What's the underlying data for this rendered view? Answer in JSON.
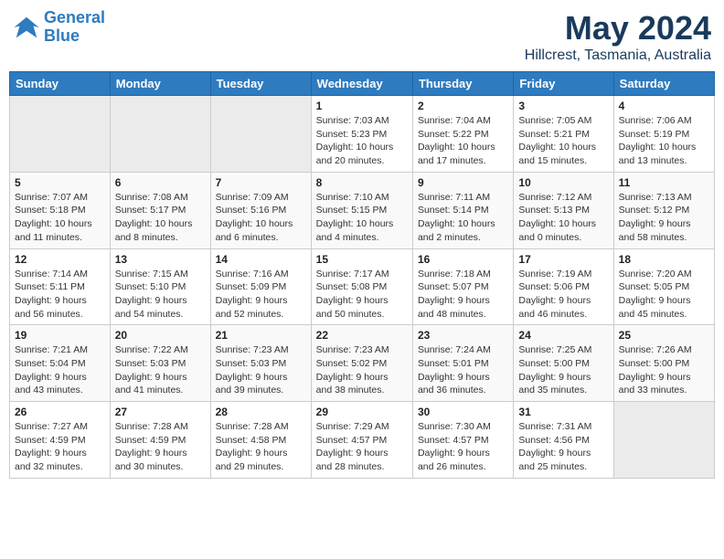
{
  "logo": {
    "line1": "General",
    "line2": "Blue"
  },
  "title": "May 2024",
  "subtitle": "Hillcrest, Tasmania, Australia",
  "weekdays": [
    "Sunday",
    "Monday",
    "Tuesday",
    "Wednesday",
    "Thursday",
    "Friday",
    "Saturday"
  ],
  "weeks": [
    {
      "days": [
        {
          "num": "",
          "info": "",
          "empty": true
        },
        {
          "num": "",
          "info": "",
          "empty": true
        },
        {
          "num": "",
          "info": "",
          "empty": true
        },
        {
          "num": "1",
          "info": "Sunrise: 7:03 AM\nSunset: 5:23 PM\nDaylight: 10 hours\nand 20 minutes."
        },
        {
          "num": "2",
          "info": "Sunrise: 7:04 AM\nSunset: 5:22 PM\nDaylight: 10 hours\nand 17 minutes."
        },
        {
          "num": "3",
          "info": "Sunrise: 7:05 AM\nSunset: 5:21 PM\nDaylight: 10 hours\nand 15 minutes."
        },
        {
          "num": "4",
          "info": "Sunrise: 7:06 AM\nSunset: 5:19 PM\nDaylight: 10 hours\nand 13 minutes."
        }
      ]
    },
    {
      "days": [
        {
          "num": "5",
          "info": "Sunrise: 7:07 AM\nSunset: 5:18 PM\nDaylight: 10 hours\nand 11 minutes."
        },
        {
          "num": "6",
          "info": "Sunrise: 7:08 AM\nSunset: 5:17 PM\nDaylight: 10 hours\nand 8 minutes."
        },
        {
          "num": "7",
          "info": "Sunrise: 7:09 AM\nSunset: 5:16 PM\nDaylight: 10 hours\nand 6 minutes."
        },
        {
          "num": "8",
          "info": "Sunrise: 7:10 AM\nSunset: 5:15 PM\nDaylight: 10 hours\nand 4 minutes."
        },
        {
          "num": "9",
          "info": "Sunrise: 7:11 AM\nSunset: 5:14 PM\nDaylight: 10 hours\nand 2 minutes."
        },
        {
          "num": "10",
          "info": "Sunrise: 7:12 AM\nSunset: 5:13 PM\nDaylight: 10 hours\nand 0 minutes."
        },
        {
          "num": "11",
          "info": "Sunrise: 7:13 AM\nSunset: 5:12 PM\nDaylight: 9 hours\nand 58 minutes."
        }
      ]
    },
    {
      "days": [
        {
          "num": "12",
          "info": "Sunrise: 7:14 AM\nSunset: 5:11 PM\nDaylight: 9 hours\nand 56 minutes."
        },
        {
          "num": "13",
          "info": "Sunrise: 7:15 AM\nSunset: 5:10 PM\nDaylight: 9 hours\nand 54 minutes."
        },
        {
          "num": "14",
          "info": "Sunrise: 7:16 AM\nSunset: 5:09 PM\nDaylight: 9 hours\nand 52 minutes."
        },
        {
          "num": "15",
          "info": "Sunrise: 7:17 AM\nSunset: 5:08 PM\nDaylight: 9 hours\nand 50 minutes."
        },
        {
          "num": "16",
          "info": "Sunrise: 7:18 AM\nSunset: 5:07 PM\nDaylight: 9 hours\nand 48 minutes."
        },
        {
          "num": "17",
          "info": "Sunrise: 7:19 AM\nSunset: 5:06 PM\nDaylight: 9 hours\nand 46 minutes."
        },
        {
          "num": "18",
          "info": "Sunrise: 7:20 AM\nSunset: 5:05 PM\nDaylight: 9 hours\nand 45 minutes."
        }
      ]
    },
    {
      "days": [
        {
          "num": "19",
          "info": "Sunrise: 7:21 AM\nSunset: 5:04 PM\nDaylight: 9 hours\nand 43 minutes."
        },
        {
          "num": "20",
          "info": "Sunrise: 7:22 AM\nSunset: 5:03 PM\nDaylight: 9 hours\nand 41 minutes."
        },
        {
          "num": "21",
          "info": "Sunrise: 7:23 AM\nSunset: 5:03 PM\nDaylight: 9 hours\nand 39 minutes."
        },
        {
          "num": "22",
          "info": "Sunrise: 7:23 AM\nSunset: 5:02 PM\nDaylight: 9 hours\nand 38 minutes."
        },
        {
          "num": "23",
          "info": "Sunrise: 7:24 AM\nSunset: 5:01 PM\nDaylight: 9 hours\nand 36 minutes."
        },
        {
          "num": "24",
          "info": "Sunrise: 7:25 AM\nSunset: 5:00 PM\nDaylight: 9 hours\nand 35 minutes."
        },
        {
          "num": "25",
          "info": "Sunrise: 7:26 AM\nSunset: 5:00 PM\nDaylight: 9 hours\nand 33 minutes."
        }
      ]
    },
    {
      "days": [
        {
          "num": "26",
          "info": "Sunrise: 7:27 AM\nSunset: 4:59 PM\nDaylight: 9 hours\nand 32 minutes."
        },
        {
          "num": "27",
          "info": "Sunrise: 7:28 AM\nSunset: 4:59 PM\nDaylight: 9 hours\nand 30 minutes."
        },
        {
          "num": "28",
          "info": "Sunrise: 7:28 AM\nSunset: 4:58 PM\nDaylight: 9 hours\nand 29 minutes."
        },
        {
          "num": "29",
          "info": "Sunrise: 7:29 AM\nSunset: 4:57 PM\nDaylight: 9 hours\nand 28 minutes."
        },
        {
          "num": "30",
          "info": "Sunrise: 7:30 AM\nSunset: 4:57 PM\nDaylight: 9 hours\nand 26 minutes."
        },
        {
          "num": "31",
          "info": "Sunrise: 7:31 AM\nSunset: 4:56 PM\nDaylight: 9 hours\nand 25 minutes."
        },
        {
          "num": "",
          "info": "",
          "empty": true
        }
      ]
    }
  ]
}
